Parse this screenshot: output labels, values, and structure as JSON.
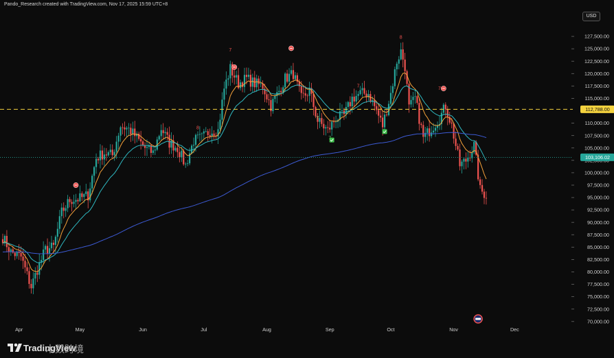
{
  "header": {
    "caption": "Pando_Research created with TradingView.com, Nov 17, 2025 15:59 UTC+8"
  },
  "currency_button": "USD",
  "footer": {
    "brand": "TradingView",
    "watermark": "木数跨境"
  },
  "colors": {
    "background": "#0c0c0c",
    "up_candle": "#26a69a",
    "down_candle": "#ef5350",
    "ema_fast": "#f7a23b",
    "ema_mid": "#2fb9c2",
    "ema_slow": "#3d5bd6",
    "resistance": "#f5d33f",
    "last_price": "#26a69a"
  },
  "chart_data": {
    "type": "candlestick",
    "title": "",
    "xlabel": "",
    "ylabel": "",
    "x_ticks": [
      "Apr",
      "May",
      "Jun",
      "Jul",
      "Aug",
      "Sep",
      "Oct",
      "Nov",
      "Dec"
    ],
    "x_range": [
      "2025-03-24",
      "2025-12-10"
    ],
    "ylim": [
      69000,
      130000
    ],
    "price_axis_labels": [
      "127,500.00",
      "125,000.00",
      "122,500.00",
      "120,000.00",
      "117,500.00",
      "115,000.00",
      "110,000.00",
      "107,500.00",
      "105,000.00",
      "102,500.00",
      "100,000.00",
      "97,500.00",
      "95,000.00",
      "92,500.00",
      "90,000.00",
      "87,500.00",
      "85,000.00",
      "82,500.00",
      "80,000.00",
      "77,500.00",
      "75,000.00",
      "72,500.00",
      "70,000.00"
    ],
    "grid": false,
    "horizontal_lines": [
      {
        "value": 112788,
        "label": "112,788.00",
        "style": "dashed",
        "color": "#f5d33f"
      }
    ],
    "last_price": {
      "value": 103106.02,
      "label": "103,106.02"
    },
    "keypoints": [
      [
        "2025-03-24",
        87000
      ],
      [
        "2025-03-28",
        84000
      ],
      [
        "2025-04-02",
        83000
      ],
      [
        "2025-04-07",
        77000
      ],
      [
        "2025-04-10",
        80500
      ],
      [
        "2025-04-14",
        84500
      ],
      [
        "2025-04-18",
        85000
      ],
      [
        "2025-04-22",
        92000
      ],
      [
        "2025-04-26",
        94500
      ],
      [
        "2025-05-01",
        94800
      ],
      [
        "2025-05-05",
        95500
      ],
      [
        "2025-05-09",
        103000
      ],
      [
        "2025-05-13",
        104000
      ],
      [
        "2025-05-17",
        103500
      ],
      [
        "2025-05-21",
        109500
      ],
      [
        "2025-05-25",
        108800
      ],
      [
        "2025-05-28",
        107500
      ],
      [
        "2025-06-02",
        105000
      ],
      [
        "2025-06-06",
        104000
      ],
      [
        "2025-06-10",
        109000
      ],
      [
        "2025-06-14",
        106000
      ],
      [
        "2025-06-18",
        105000
      ],
      [
        "2025-06-22",
        101500
      ],
      [
        "2025-06-26",
        106500
      ],
      [
        "2025-06-30",
        107000
      ],
      [
        "2025-07-04",
        108500
      ],
      [
        "2025-07-08",
        108500
      ],
      [
        "2025-07-11",
        117000
      ],
      [
        "2025-07-14",
        121000
      ],
      [
        "2025-07-18",
        118000
      ],
      [
        "2025-07-22",
        119000
      ],
      [
        "2025-07-26",
        118000
      ],
      [
        "2025-07-30",
        117500
      ],
      [
        "2025-08-03",
        113500
      ],
      [
        "2025-08-07",
        116500
      ],
      [
        "2025-08-10",
        119000
      ],
      [
        "2025-08-14",
        120000
      ],
      [
        "2025-08-18",
        115000
      ],
      [
        "2025-08-22",
        116500
      ],
      [
        "2025-08-26",
        110500
      ],
      [
        "2025-08-31",
        108500
      ],
      [
        "2025-09-04",
        111000
      ],
      [
        "2025-09-08",
        111500
      ],
      [
        "2025-09-12",
        115000
      ],
      [
        "2025-09-16",
        116000
      ],
      [
        "2025-09-20",
        116000
      ],
      [
        "2025-09-24",
        112500
      ],
      [
        "2025-09-27",
        109500
      ],
      [
        "2025-10-01",
        116000
      ],
      [
        "2025-10-04",
        122500
      ],
      [
        "2025-10-06",
        124500
      ],
      [
        "2025-10-08",
        121500
      ],
      [
        "2025-10-10",
        113000
      ],
      [
        "2025-10-13",
        115000
      ],
      [
        "2025-10-17",
        107000
      ],
      [
        "2025-10-21",
        109000
      ],
      [
        "2025-10-25",
        111000
      ],
      [
        "2025-10-28",
        113500
      ],
      [
        "2025-10-31",
        109500
      ],
      [
        "2025-11-04",
        101500
      ],
      [
        "2025-11-07",
        102500
      ],
      [
        "2025-11-11",
        105500
      ],
      [
        "2025-11-14",
        96500
      ],
      [
        "2025-11-17",
        95500
      ]
    ],
    "series": [
      {
        "kind": "ema",
        "color": "#f7a23b",
        "period": 9
      },
      {
        "kind": "ema",
        "color": "#2fb9c2",
        "period": 21
      },
      {
        "kind": "ema",
        "color": "#3d5bd6",
        "period": 200
      }
    ],
    "td_markers": [
      {
        "date": "2025-04-29",
        "value": 97500,
        "text": "",
        "kind": "sell"
      },
      {
        "date": "2025-06-28",
        "value": 108800,
        "text": "8",
        "kind": "num"
      },
      {
        "date": "2025-07-14",
        "value": 124500,
        "text": "7",
        "kind": "num"
      },
      {
        "date": "2025-07-16",
        "value": 121300,
        "text": "",
        "kind": "sell"
      },
      {
        "date": "2025-08-13",
        "value": 125100,
        "text": "",
        "kind": "sell"
      },
      {
        "date": "2025-08-26",
        "value": 110800,
        "text": "7",
        "kind": "numg"
      },
      {
        "date": "2025-09-01",
        "value": 106700,
        "text": "7",
        "kind": "numg"
      },
      {
        "date": "2025-09-02",
        "value": 106600,
        "text": "",
        "kind": "buy"
      },
      {
        "date": "2025-09-15",
        "value": 117200,
        "text": "7",
        "kind": "num"
      },
      {
        "date": "2025-09-28",
        "value": 108300,
        "text": "",
        "kind": "buy"
      },
      {
        "date": "2025-10-06",
        "value": 127000,
        "text": "8",
        "kind": "num"
      },
      {
        "date": "2025-10-25",
        "value": 116700,
        "text": "7",
        "kind": "num"
      },
      {
        "date": "2025-10-27",
        "value": 117000,
        "text": "",
        "kind": "sell"
      }
    ]
  }
}
